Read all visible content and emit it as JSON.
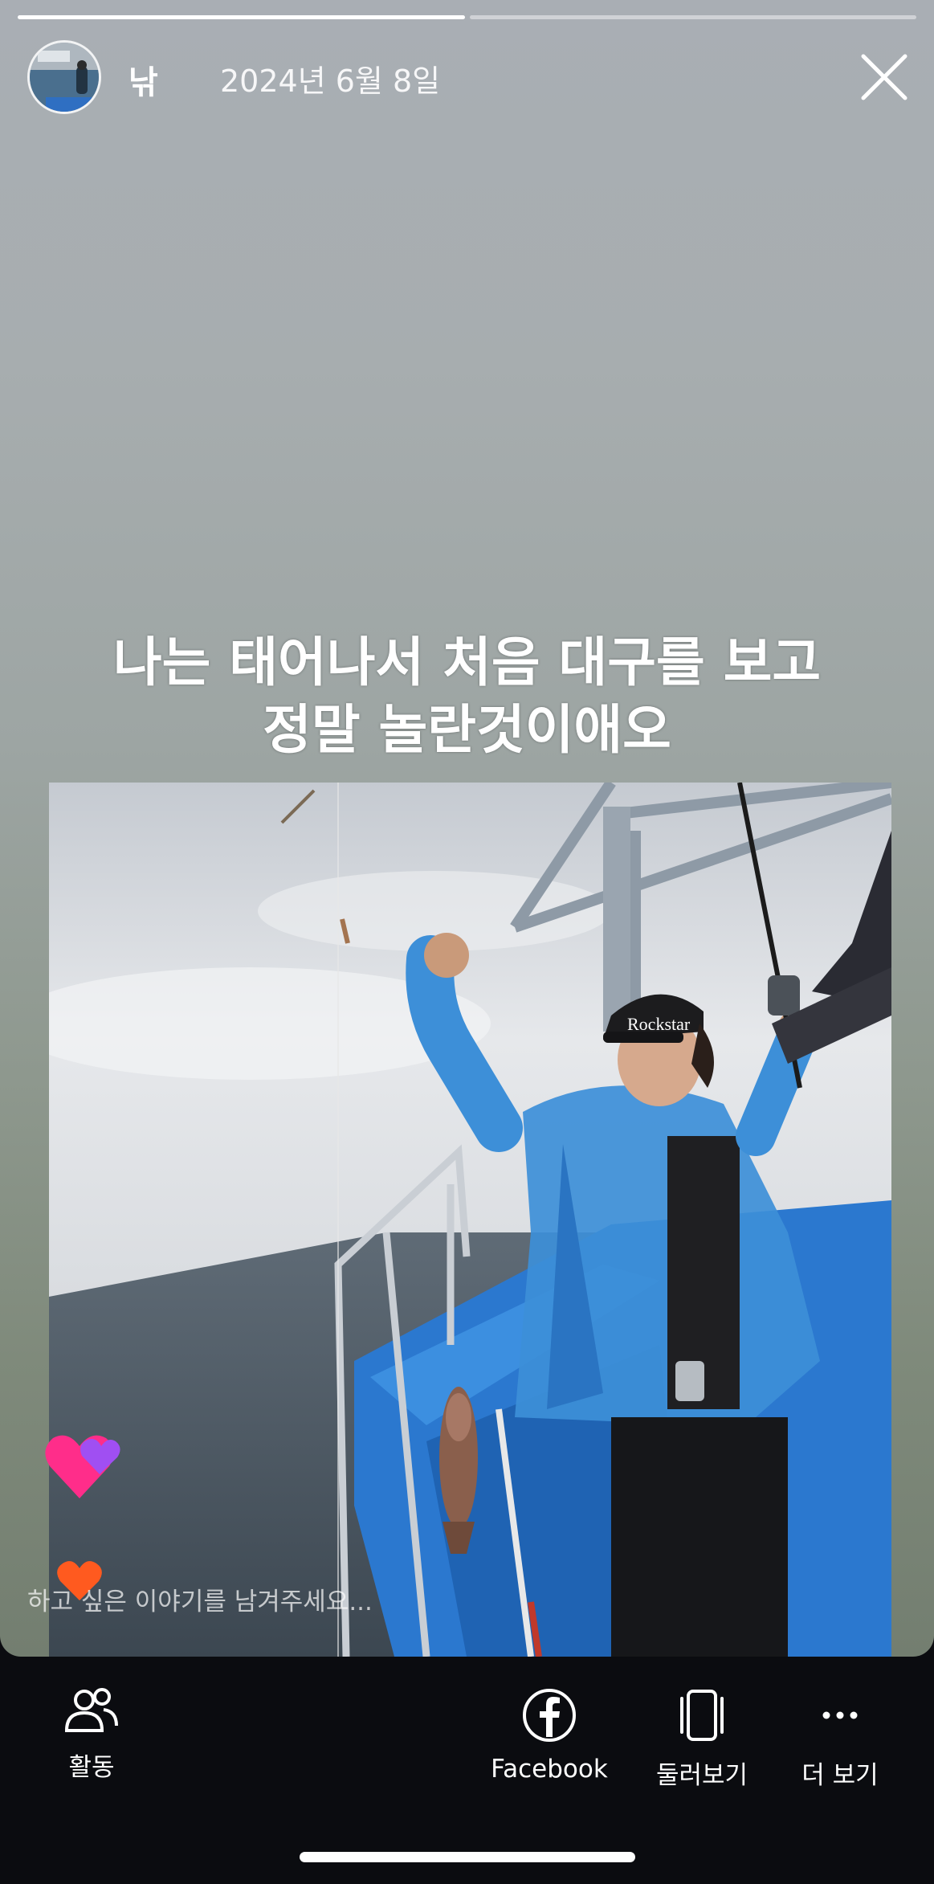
{
  "story": {
    "username": "낚",
    "date": "2024년 6월 8일",
    "caption_line1": "나는 태어나서 처음 대구를 보고",
    "caption_line2": "정말 놀란것이애오",
    "progress": {
      "total_segments": 2,
      "completed_segments": 1
    },
    "reply_placeholder": "하고 싶은 이야기를 남겨주세요..."
  },
  "photo": {
    "cap_text": "Rockstar"
  },
  "bottom_bar": {
    "activity_label": "활동",
    "facebook_label": "Facebook",
    "browse_label": "둘러보기",
    "more_label": "더 보기"
  },
  "icons": {
    "close": "close-icon",
    "activity": "people-icon",
    "facebook": "facebook-icon",
    "browse": "carousel-icon",
    "more": "ellipsis-icon"
  },
  "colors": {
    "bar_bg": "#0b0c10",
    "raincoat": "#3d8fd8",
    "boat": "#2b78cf"
  }
}
